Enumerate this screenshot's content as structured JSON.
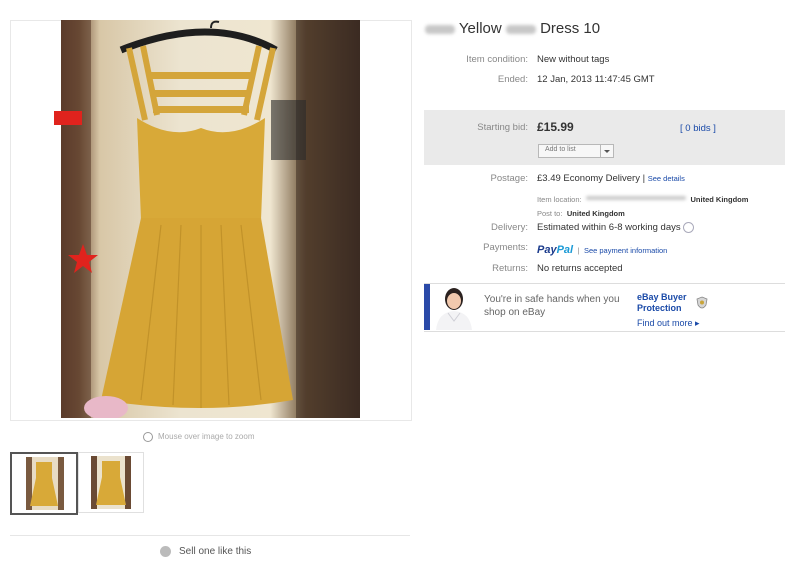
{
  "gallery": {
    "zoom_hint": "Mouse over image to zoom",
    "sell_text": "Sell one like this"
  },
  "item": {
    "title_word1": "Yellow",
    "title_word2": "Dress 10",
    "condition_label": "Item condition:",
    "condition_value": "New without tags",
    "ended_label": "Ended:",
    "ended_value": "12 Jan, 2013  11:47:45 GMT"
  },
  "bidding": {
    "starting_bid_label": "Starting bid:",
    "price": "£15.99",
    "bids": "[ 0 bids ]",
    "add_to_list": "Add to list"
  },
  "postage": {
    "label": "Postage:",
    "cost": "£3.49",
    "method": "Economy Delivery",
    "separator": "|",
    "details_link": "See details",
    "item_location_label": "Item location:",
    "item_location_value": "United Kingdom",
    "post_to_label": "Post to:",
    "post_to_value": "United Kingdom"
  },
  "delivery": {
    "label": "Delivery:",
    "value": "Estimated within 6-8 working days"
  },
  "payments": {
    "label": "Payments:",
    "paypal_pay": "Pay",
    "paypal_pal": "Pal",
    "separator": "|",
    "info_link": "See payment information"
  },
  "returns": {
    "label": "Returns:",
    "value": "No returns accepted"
  },
  "buyer_protection": {
    "message": "You're in safe hands when you shop on eBay",
    "title": "eBay Buyer Protection",
    "link": "Find out more ▸"
  },
  "colors": {
    "link": "#1a4aa8",
    "dress": "#d8a938",
    "paypal_dark": "#1b3b8c",
    "paypal_light": "#1a9ad6"
  }
}
